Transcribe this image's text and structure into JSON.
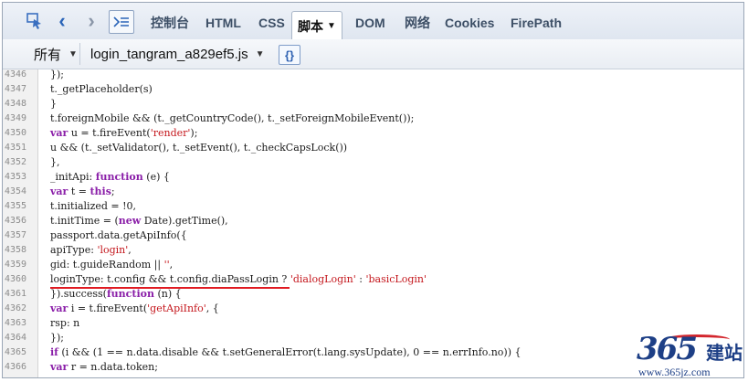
{
  "tabs": [
    {
      "label": "控制台"
    },
    {
      "label": "HTML"
    },
    {
      "label": "CSS"
    },
    {
      "label": "脚本",
      "active": true
    },
    {
      "label": "DOM"
    },
    {
      "label": "网络"
    },
    {
      "label": "Cookies"
    },
    {
      "label": "FirePath"
    }
  ],
  "toolbar": {
    "filter_label": "所有",
    "file_name": "login_tangram_a829ef5.js",
    "pretty_print": "{}"
  },
  "code_lines": [
    {
      "num": "4346",
      "code": "});"
    },
    {
      "num": "4347",
      "code": "t._getPlaceholder(s)"
    },
    {
      "num": "4348",
      "code": "}"
    },
    {
      "num": "4349",
      "code": "t.foreignMobile && (t._getCountryCode(), t._setForeignMobileEvent());"
    },
    {
      "num": "4350",
      "code": "var u = t.fireEvent('render');"
    },
    {
      "num": "4351",
      "code": "u && (t._setValidator(), t._setEvent(), t._checkCapsLock())"
    },
    {
      "num": "4352",
      "code": "},"
    },
    {
      "num": "4353",
      "code": "_initApi: function (e) {"
    },
    {
      "num": "4354",
      "code": "var t = this;"
    },
    {
      "num": "4355",
      "code": "t.initialized = !0,"
    },
    {
      "num": "4356",
      "code": "t.initTime = (new Date).getTime(),"
    },
    {
      "num": "4357",
      "code": "passport.data.getApiInfo({"
    },
    {
      "num": "4358",
      "code": "apiType: 'login',"
    },
    {
      "num": "4359",
      "code": "gid: t.guideRandom || '',"
    },
    {
      "num": "4360",
      "code": "loginType: t.config && t.config.diaPassLogin ? 'dialogLogin' : 'basicLogin'"
    },
    {
      "num": "4361",
      "code": "}).success(function (n) {"
    },
    {
      "num": "4362",
      "code": "var i = t.fireEvent('getApiInfo', {"
    },
    {
      "num": "4363",
      "code": "rsp: n"
    },
    {
      "num": "4364",
      "code": "});"
    },
    {
      "num": "4365",
      "code": "if (i && (1 == n.data.disable && t.setGeneralError(t.lang.sysUpdate), 0 == n.errInfo.no)) {"
    },
    {
      "num": "4366",
      "code": "var r = n.data.token;"
    }
  ],
  "scroll_indicator": "...",
  "watermark": {
    "number": "365",
    "brand": "建站",
    "url": "www.365jz.com"
  },
  "colors": {
    "keyword": "#8a1ea8",
    "string": "#c4161c",
    "highlight_underline": "#e01b22",
    "tab_text": "#3d4f66"
  },
  "icons": [
    "inspect-icon",
    "back-arrow-icon",
    "forward-arrow-icon",
    "console-toggle-icon",
    "chevron-down-icon"
  ]
}
